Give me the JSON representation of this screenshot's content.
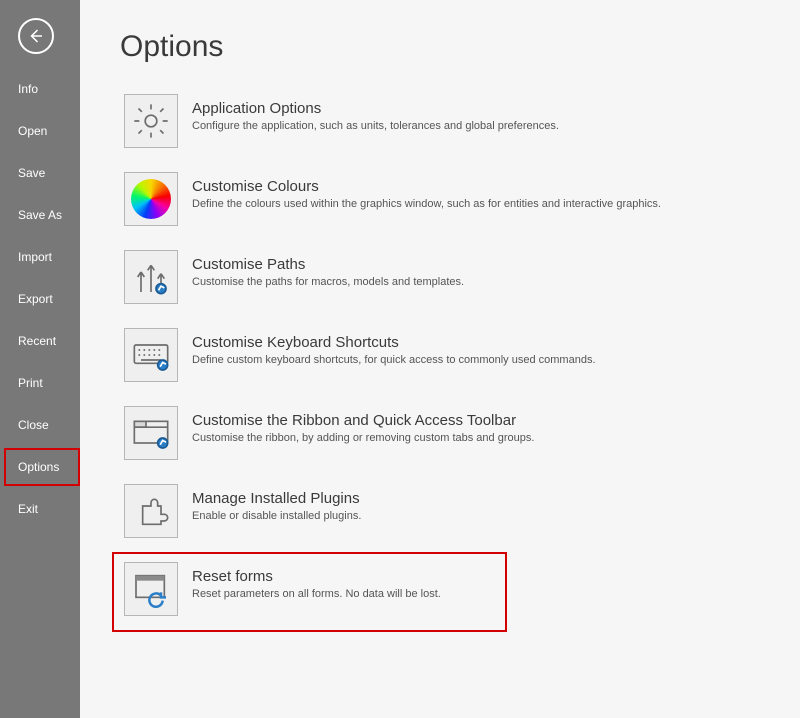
{
  "sidebar": {
    "items": [
      {
        "label": "Info"
      },
      {
        "label": "Open"
      },
      {
        "label": "Save"
      },
      {
        "label": "Save As"
      },
      {
        "label": "Import"
      },
      {
        "label": "Export"
      },
      {
        "label": "Recent"
      },
      {
        "label": "Print"
      },
      {
        "label": "Close"
      },
      {
        "label": "Options",
        "highlighted": true
      },
      {
        "label": "Exit"
      }
    ]
  },
  "page": {
    "title": "Options"
  },
  "options": [
    {
      "title": "Application Options",
      "desc": "Configure the application, such as units, tolerances and global preferences.",
      "icon": "gear-icon"
    },
    {
      "title": "Customise Colours",
      "desc": "Define the colours used within the graphics window, such as for entities and interactive graphics.",
      "icon": "color-wheel-icon"
    },
    {
      "title": "Customise Paths",
      "desc": "Customise the paths for macros, models and templates.",
      "icon": "paths-icon"
    },
    {
      "title": "Customise Keyboard Shortcuts",
      "desc": "Define custom keyboard shortcuts, for quick access to commonly used commands.",
      "icon": "keyboard-icon"
    },
    {
      "title": "Customise the Ribbon and Quick Access Toolbar",
      "desc": "Customise the ribbon, by adding or removing custom tabs and groups.",
      "icon": "ribbon-icon"
    },
    {
      "title": "Manage Installed Plugins",
      "desc": "Enable or disable installed plugins.",
      "icon": "plugin-icon"
    },
    {
      "title": "Reset forms",
      "desc": "Reset parameters on all forms. No data will be lost.",
      "icon": "reset-icon",
      "highlighted": true
    }
  ]
}
